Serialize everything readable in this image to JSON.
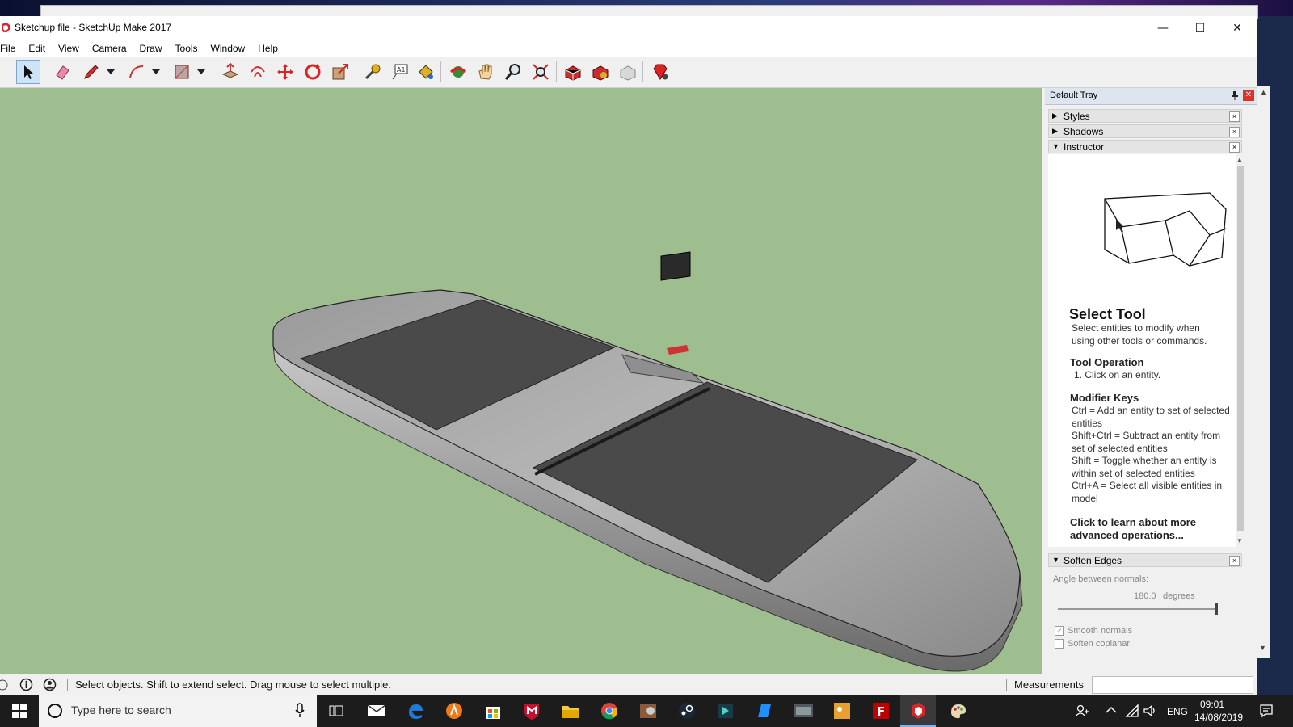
{
  "window": {
    "title": "Sketchup file - SketchUp Make 2017",
    "minimize_glyph": "—",
    "maximize_glyph": "☐",
    "close_glyph": "✕"
  },
  "menu": [
    "File",
    "Edit",
    "View",
    "Camera",
    "Draw",
    "Tools",
    "Window",
    "Help"
  ],
  "toolbar": {
    "tools": [
      "select-tool",
      "eraser-tool",
      "line-tool",
      "arc-tool",
      "shape-tool",
      "push-pull-tool",
      "offset-tool",
      "move-tool",
      "rotate-tool",
      "scale-tool",
      "tape-measure-tool",
      "text-tool",
      "paint-bucket-tool",
      "orbit-tool",
      "pan-tool",
      "zoom-tool",
      "zoom-extents-tool",
      "3d-warehouse-tool",
      "extension-warehouse-tool",
      "layout-tool",
      "ruby-console-tool"
    ],
    "active_tool": "select-tool"
  },
  "tray": {
    "title": "Default Tray",
    "panels": {
      "styles": "Styles",
      "shadows": "Shadows",
      "instructor": "Instructor",
      "soften_edges": "Soften Edges"
    },
    "instructor": {
      "heading": "Select Tool",
      "intro": "Select entities to modify when using other tools or commands.",
      "operation_heading": "Tool Operation",
      "operation_step": "1. Click on an entity.",
      "modifier_heading": "Modifier Keys",
      "modifier_ctrl": "Ctrl = Add an entity to set of selected entities",
      "modifier_shift_ctrl": "Shift+Ctrl = Subtract an entity from set of selected entities",
      "modifier_shift": "Shift = Toggle whether an entity is within set of selected entities",
      "modifier_ctrl_a": "Ctrl+A = Select all visible entities in model",
      "learn_more": "Click to learn about more advanced operations..."
    },
    "soften": {
      "angle_label": "Angle between normals:",
      "angle_value": "180.0",
      "angle_unit": "degrees",
      "slider_level": 1.0,
      "smooth_normals_label": "Smooth normals",
      "smooth_normals_checked": true,
      "soften_coplanar_label": "Soften coplanar",
      "soften_coplanar_checked": false
    }
  },
  "status": {
    "hint": "Select objects. Shift to extend select. Drag mouse to select multiple.",
    "measurements_label": "Measurements",
    "measurements_value": ""
  },
  "taskbar": {
    "search_placeholder": "Type here to search",
    "apps": [
      "start-icon",
      "cortana-icon",
      "task-view-icon",
      "mail-icon",
      "edge-icon",
      "avast-icon",
      "store-icon",
      "mcafee-icon",
      "file-explorer-icon",
      "chrome-icon",
      "photo-app-icon",
      "steam-icon",
      "media-app-icon",
      "notes-app-icon",
      "media-player-icon",
      "image-app-icon",
      "filezilla-icon",
      "sketchup-icon",
      "paint-app-icon"
    ],
    "language": "ENG",
    "time": "09:01",
    "date": "14/08/2019"
  },
  "colors": {
    "viewport_bg": "#9ebe8f",
    "sketchup_red": "#d8262c",
    "taskbar_bg": "#1c1c1c"
  }
}
